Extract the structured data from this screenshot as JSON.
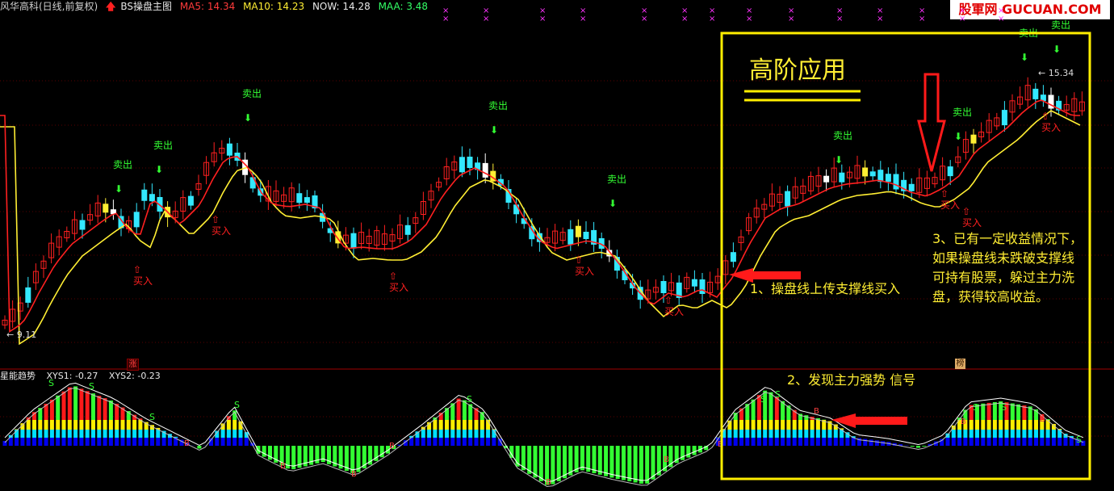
{
  "header": {
    "title": "风华高科(日线,前复权)",
    "indicator_name": "BS操盘主图",
    "ma5_label": "MA5: 14.34",
    "ma10_label": "MA10: 14.23",
    "now_label": "NOW: 14.28",
    "maa_label": "MAA: 3.48"
  },
  "brand": "股軍网 GUCUAN.COM",
  "price_markers": {
    "low": "9.11",
    "high": "15.34"
  },
  "tags": {
    "zhang": "涨",
    "bang": "榜"
  },
  "main_labels": {
    "sell": "卖出",
    "buy": "买入"
  },
  "sub_header": {
    "name": "星能趋势",
    "xys1": "XYS1: -0.27",
    "xys2": "XYS2: -0.23"
  },
  "annotations": {
    "headline": "高阶应用",
    "note1": "1、操盘线上传支撑线买入",
    "note2": "2、发现主力强势 信号",
    "note3": "3、已有一定收益情况下，如果操盘线未跌破支撑线可持有股票，躲过主力洗盘，获得较高收益。"
  },
  "colors": {
    "up": "#ff2020",
    "down": "#33e8ff",
    "ma_red": "#ff2020",
    "support_yellow": "#ffee33",
    "signal_green": "#33ff33",
    "highlight_box": "#ffee00"
  }
}
